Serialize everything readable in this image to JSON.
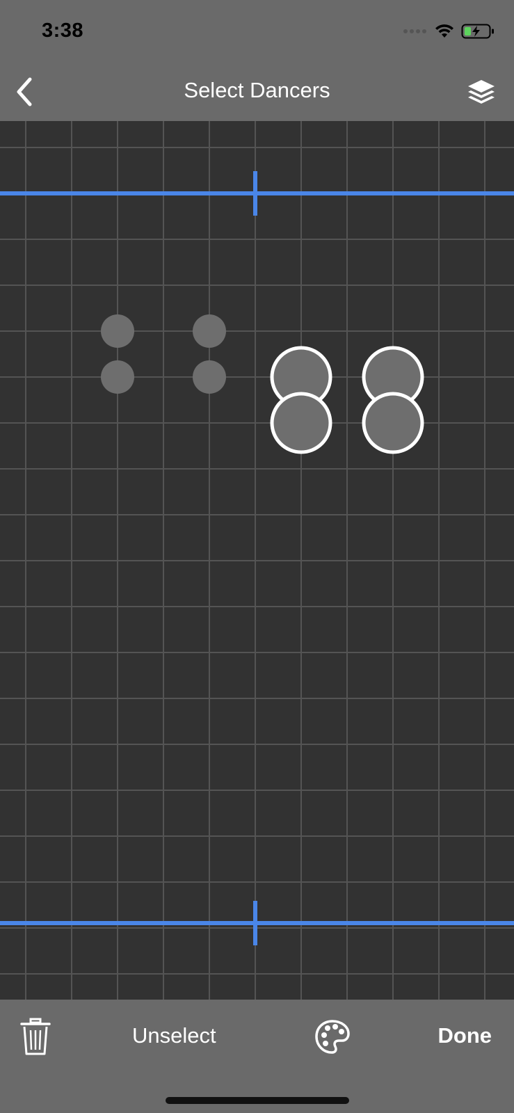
{
  "status_bar": {
    "time": "3:38",
    "icons": [
      "signal-icon",
      "wifi-icon",
      "battery-charging-icon"
    ],
    "battery_color": "#5dd35d"
  },
  "nav": {
    "title": "Select Dancers",
    "back_icon": "chevron-left-icon",
    "layers_icon": "layers-icon"
  },
  "stage": {
    "background": "#323232",
    "grid_color": "#545454",
    "marker_color": "#4a86e8",
    "dancers_unselected": [
      {
        "col": 2,
        "row": 8
      },
      {
        "col": 4,
        "row": 8
      },
      {
        "col": 2,
        "row": 10
      },
      {
        "col": 4,
        "row": 10
      }
    ],
    "dancers_selected": [
      {
        "col": 6,
        "row": 10
      },
      {
        "col": 8,
        "row": 10
      },
      {
        "col": 6,
        "row": 12
      },
      {
        "col": 8,
        "row": 12
      }
    ]
  },
  "toolbar": {
    "trash_icon": "trash-icon",
    "unselect_label": "Unselect",
    "palette_icon": "palette-icon",
    "done_label": "Done"
  }
}
